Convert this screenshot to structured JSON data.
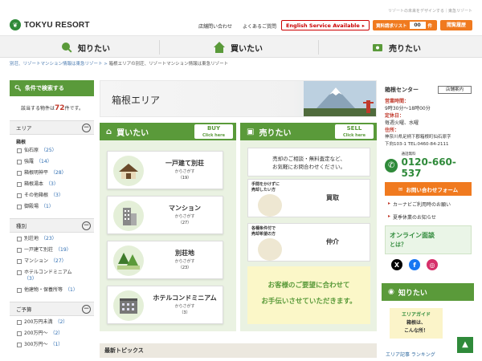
{
  "header": {
    "logo_text": "TOKYU RESORT",
    "tagline": "リゾートの未来をデザインする｜東急リゾート",
    "links": [
      "店舗問い合わせ",
      "よくあるご質問"
    ],
    "english_btn": "English Service Available",
    "request_btn": "資料請求リスト",
    "request_count": "00",
    "request_unit": "件",
    "history_btn": "閲覧履歴"
  },
  "nav": {
    "items": [
      "知りたい",
      "買いたい",
      "売りたい"
    ]
  },
  "breadcrumb": {
    "home": "別荘、リゾートマンション情報は東急リゾート",
    "sep": ">",
    "current": "箱根エリアの別荘、リゾートマンション情報は東急リゾート"
  },
  "sidebar": {
    "title": "条件で検索する",
    "count_prefix": "該当する物件は",
    "count": "72",
    "count_suffix": "件です。",
    "sections": [
      {
        "title": "エリア",
        "sub": "箱根",
        "items": [
          {
            "label": "仙石原",
            "count": "（25）"
          },
          {
            "label": "強羅",
            "count": "（14）"
          },
          {
            "label": "箱根明神平",
            "count": "（28）"
          },
          {
            "label": "箱根湯本",
            "count": "（3）"
          },
          {
            "label": "その他箱根",
            "count": "（3）"
          },
          {
            "label": "御殿場",
            "count": "（1）"
          }
        ]
      },
      {
        "title": "種別",
        "items": [
          {
            "label": "別荘地",
            "count": "（23）"
          },
          {
            "label": "一戸建て別荘",
            "count": "（19）"
          },
          {
            "label": "マンション",
            "count": "（27）"
          },
          {
            "label": "ホテルコンドミニアム",
            "count": "（3）"
          },
          {
            "label": "他建物・保養所等",
            "count": "（1）"
          }
        ]
      },
      {
        "title": "ご予算",
        "items": [
          {
            "label": "200万円未満",
            "count": "（2）"
          },
          {
            "label": "200万円～",
            "count": "（2）"
          },
          {
            "label": "300万円～",
            "count": "（1）"
          }
        ]
      }
    ]
  },
  "main": {
    "area_title": "箱根エリア",
    "buy": {
      "title": "買いたい",
      "tag": "BUY",
      "tag_sub": "Click here",
      "cards": [
        {
          "title": "一戸建て別荘",
          "sub": "からさがす",
          "count": "（19）"
        },
        {
          "title": "マンション",
          "sub": "からさがす",
          "count": "（27）"
        },
        {
          "title": "別荘地",
          "sub": "からさがす",
          "count": "（23）"
        },
        {
          "title": "ホテルコンドミニアム",
          "sub": "からさがす",
          "count": "（3）"
        }
      ]
    },
    "sell": {
      "title": "売りたい",
      "tag": "SELL",
      "tag_sub": "Click here",
      "note_1": "売却のご相談・無料査定など、",
      "note_2": "お気軽にお問合わせください。",
      "cards": [
        {
          "bubble_1": "手間をかけずに",
          "bubble_2": "売却したい方",
          "title": "買取"
        },
        {
          "bubble_1": "各種条件付で",
          "bubble_2": "売却希望の方",
          "title": "仲介"
        }
      ],
      "consult_1": "お客様のご要望に合わせて",
      "consult_2": "お手伝いさせていただきます。"
    },
    "news_title": "最新トピックス"
  },
  "right": {
    "center_title": "箱根センター",
    "shop_badge": "店舗案内",
    "hours_label": "営業時間：",
    "hours": "9時30分～18時00分",
    "holiday_label": "定休日：",
    "holiday": "毎週火曜、水曜",
    "addr_label": "住所：",
    "addr_1": "神奈川県足柄下郡箱根町仙石原字",
    "addr_2": "下向103-1",
    "tel": "TEL:0460-84-2111",
    "fax": "FAX:0460-84-2234",
    "free_label": "通話無料",
    "phone": "0120-660-537",
    "mail_btn": "お問い合わせフォーム",
    "link_1": "カーナビご利用時のお願い",
    "link_2": "夏季休業のお知らせ",
    "online_1": "オンライン面談",
    "online_2": "とは？",
    "know_title": "知りたい",
    "guide_1": "エリアガイド",
    "guide_2": "箱根は、",
    "guide_3": "こんな所！",
    "rank": "エリア記事 ランキング"
  },
  "colors": {
    "green": "#5a9a3a",
    "orange": "#f07a1f",
    "red": "#c0392b"
  }
}
